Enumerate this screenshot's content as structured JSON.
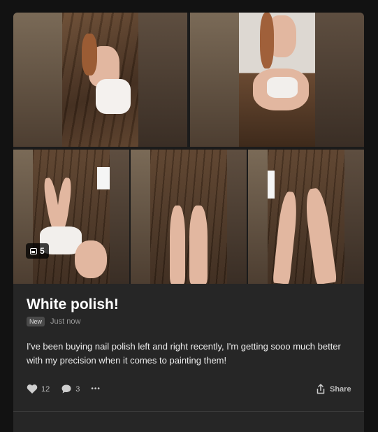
{
  "post": {
    "image_count": "5",
    "title": "White polish!",
    "badge": "New",
    "time": "Just now",
    "body": "I've been buying nail polish left and right recently, I'm getting sooo much better with my precision when it comes to painting them!",
    "likes": "12",
    "comments": "3",
    "more_label": "•••",
    "share_label": "Share"
  },
  "icons": [
    "image-icon",
    "heart-icon",
    "comment-icon",
    "more-icon",
    "share-icon"
  ],
  "colors": {
    "background": "#121212",
    "card": "#262626",
    "text": "#f2f2f2",
    "muted": "#9a9a9a"
  }
}
